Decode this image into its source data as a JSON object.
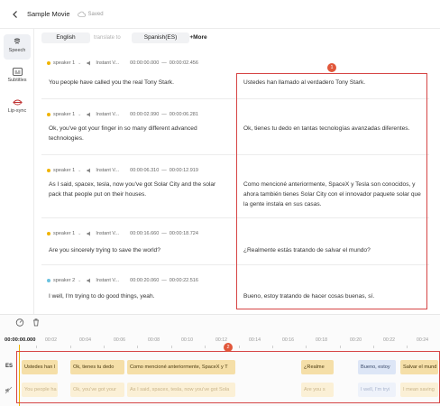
{
  "header": {
    "title": "Sample Movie",
    "saved": "Saved"
  },
  "rail": {
    "items": [
      {
        "label": "Speech"
      },
      {
        "label": "Subtitles"
      },
      {
        "label": "Lip-sync"
      }
    ]
  },
  "langbar": {
    "source": "English",
    "translate_to": "translate to",
    "target": "Spanish(ES)",
    "more": "More"
  },
  "segments": [
    {
      "speaker": "speaker 1",
      "voice": "Instant V...",
      "start": "00:00:00.000",
      "end": "00:00:02.456",
      "source": "You people have called you the real Tony Stark.",
      "target": "Ustedes han llamado al verdadero Tony Stark."
    },
    {
      "speaker": "speaker 1",
      "voice": "Instant V...",
      "start": "00:00:02.990",
      "end": "00:00:06.281",
      "source": "Ok, you've got your finger in so many different advanced technologies.",
      "target": "Ok, tienes tu dedo en tantas tecnologías avanzadas diferentes."
    },
    {
      "speaker": "speaker 1",
      "voice": "Instant V...",
      "start": "00:00:06.310",
      "end": "00:00:12.919",
      "source": "As I said, spacex, tesla, now you've got Solar City and the solar pack that people put on their houses.",
      "target": "Como mencioné anteriormente, SpaceX y Tesla son conocidos, y ahora también tienes Solar City con el innovador paquete solar que la gente instala en sus casas."
    },
    {
      "speaker": "speaker 1",
      "voice": "Instant V...",
      "start": "00:00:16.660",
      "end": "00:00:18.724",
      "source": "Are you sincerely trying to save the world?",
      "target": "¿Realmente estás tratando de salvar el mundo?"
    },
    {
      "speaker": "speaker 2",
      "voice": "Instant V...",
      "start": "00:00:20.060",
      "end": "00:00:22.516",
      "source": "I well, I'm trying to do good things, yeah.",
      "target": "Bueno, estoy tratando de hacer cosas buenas, sí."
    }
  ],
  "annotations": {
    "badge1": "1",
    "badge2": "2"
  },
  "timeline": {
    "current_time": "00:00:00.000",
    "ruler": [
      "00:02",
      "00:04",
      "00:06",
      "00:08",
      "00:10",
      "00:12",
      "00:14",
      "00:16",
      "00:18",
      "00:20",
      "00:22",
      "00:24"
    ],
    "track_label": "ES",
    "es_clips": [
      "Ustedes han l",
      "Ok, tienes tu dedo",
      "Como mencioné anteriormente, SpaceX y T",
      "¿Realme",
      "Bueno, estoy",
      "Salvar el mund"
    ],
    "en_clips": [
      "You people ha",
      "Ok, you've got your",
      "As I said, spacex, tesla, now you've got Sola",
      "Are you s",
      "I well, I'm tryi",
      "I mean saving"
    ]
  },
  "colors": {
    "accent": "#e1573a",
    "clip_es": "#f5dfa8",
    "clip_selected": "#dde6f6",
    "playhead": "#f0b400"
  }
}
